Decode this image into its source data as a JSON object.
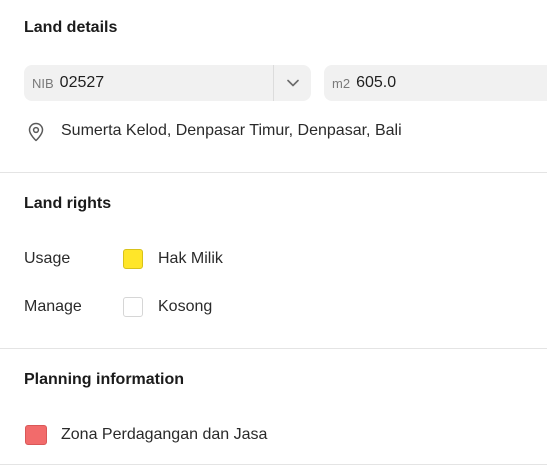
{
  "land_details": {
    "title": "Land details",
    "nib_prefix": "NIB",
    "nib_value": "02527",
    "area_prefix": "m2",
    "area_value": "605.0",
    "location": "Sumerta Kelod, Denpasar Timur, Denpasar, Bali"
  },
  "land_rights": {
    "title": "Land rights",
    "rows": [
      {
        "label": "Usage",
        "value": "Hak Milik",
        "color": "#FFE629"
      },
      {
        "label": "Manage",
        "value": "Kosong",
        "color": "#FFFFFF"
      }
    ]
  },
  "planning": {
    "title": "Planning information",
    "zone": "Zona Perdagangan dan Jasa",
    "zone_color": "#F26B6B"
  },
  "icons": {
    "location": "map-pin-icon",
    "dropdown": "chevron-down-icon"
  }
}
